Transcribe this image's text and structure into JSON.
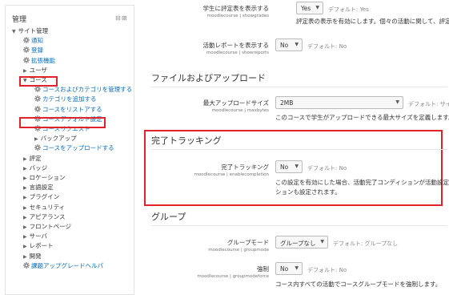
{
  "sidebar": {
    "title": "管理",
    "control_glyph": "⊟⊞",
    "items": [
      {
        "label": "サイト管理",
        "kind": "plain",
        "tri": "▼"
      },
      {
        "label": "通知",
        "kind": "link",
        "gear": true
      },
      {
        "label": "登録",
        "kind": "link",
        "gear": true
      },
      {
        "label": "拡張機能",
        "kind": "link",
        "gear": true
      },
      {
        "label": "ユーザ",
        "kind": "plain",
        "tri": "▶"
      },
      {
        "label": "コース",
        "kind": "plain",
        "tri": "▼"
      },
      {
        "label": "コースおよびカテゴリを管理する",
        "kind": "link",
        "gear": true
      },
      {
        "label": "カテゴリを追加する",
        "kind": "link",
        "gear": true
      },
      {
        "label": "コースをリストアする",
        "kind": "link",
        "gear": true
      },
      {
        "label": "コースデフォルト設定",
        "kind": "link",
        "gear": true
      },
      {
        "label": "コースリクエスト",
        "kind": "link",
        "gear": true
      },
      {
        "label": "バックアップ",
        "kind": "plain",
        "tri": "▶"
      },
      {
        "label": "コースをアップロードする",
        "kind": "link",
        "gear": true
      },
      {
        "label": "評定",
        "kind": "plain",
        "tri": "▶"
      },
      {
        "label": "バッジ",
        "kind": "plain",
        "tri": "▶"
      },
      {
        "label": "ロケーション",
        "kind": "plain",
        "tri": "▶"
      },
      {
        "label": "言語設定",
        "kind": "plain",
        "tri": "▶"
      },
      {
        "label": "プラグイン",
        "kind": "plain",
        "tri": "▶"
      },
      {
        "label": "セキュリティ",
        "kind": "plain",
        "tri": "▶"
      },
      {
        "label": "アピアランス",
        "kind": "plain",
        "tri": "▶"
      },
      {
        "label": "フロントページ",
        "kind": "plain",
        "tri": "▶"
      },
      {
        "label": "サーバ",
        "kind": "plain",
        "tri": "▶"
      },
      {
        "label": "レポート",
        "kind": "plain",
        "tri": "▶"
      },
      {
        "label": "開発",
        "kind": "plain",
        "tri": "▶"
      },
      {
        "label": "課題アップグレードヘルパ",
        "kind": "link",
        "gear": true
      }
    ]
  },
  "settings": {
    "showgrades": {
      "label": "学生に評定表を表示する",
      "sub": "moodlecourse | showgrades",
      "value": "Yes",
      "default": "デフォルト: Yes",
      "desc": "評定表の表示を有効にします。個々の活動に関して、評定表の表"
    },
    "showreports": {
      "label": "活動レポートを表示する",
      "sub": "moodlecourse | showreports",
      "value": "No",
      "default": "デフォルト: No"
    },
    "files_heading": "ファイルおよびアップロード",
    "maxbytes": {
      "label": "最大アップロードサイズ",
      "sub": "moodlecourse | maxbytes",
      "value": "2MB",
      "default": "デフォルト: サイト アップ",
      "desc": "このコースで学生がアップロードできる最大サイズを定義します。"
    },
    "completion_heading": "完了トラッキング",
    "enablecompletion": {
      "label": "完了トラッキング",
      "sub": "moodlecourse | enablecompletion",
      "value": "No",
      "default": "デフォルト: No",
      "desc1": "この設定を有効にした場合、活動完了コンディションが活動設定",
      "desc2": "ションも設定されます。"
    },
    "groups_heading": "グループ",
    "groupmode": {
      "label": "グループモード",
      "sub": "moodlecourse | groupmode",
      "value": "グループなし",
      "default": "デフォルト: グループなし"
    },
    "groupmodeforce": {
      "label": "強制",
      "sub": "moodlecourse | groupmodeforce",
      "value": "No",
      "default": "デフォルト: No",
      "desc": "コース内すべての活動でコースグループモードを強制します。"
    }
  },
  "colors": {
    "link": "#0a6cbc",
    "highlight": "#e0232b"
  }
}
